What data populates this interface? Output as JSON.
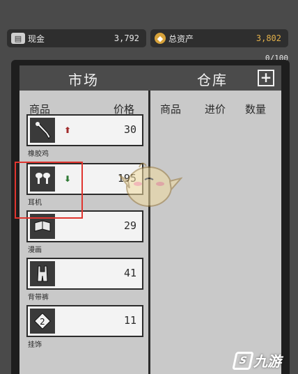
{
  "header": {
    "cash": {
      "label": "现金",
      "value": "3,792",
      "icon": "cash-stack-icon"
    },
    "total_assets": {
      "label": "总资产",
      "value": "3,802",
      "icon": "asset-coin-icon"
    }
  },
  "capacity": "0/100",
  "market": {
    "title": "市场",
    "col_item": "商品",
    "col_price": "价格",
    "items": [
      {
        "name": "橡胶鸡",
        "price": "30",
        "trend": "up",
        "trend_glyph": "⬆",
        "icon": "rubber-chicken-icon"
      },
      {
        "name": "耳机",
        "price": "195",
        "trend": "down",
        "trend_glyph": "⬇",
        "icon": "earbuds-icon"
      },
      {
        "name": "漫画",
        "price": "29",
        "trend": "none",
        "trend_glyph": "",
        "icon": "comic-book-icon"
      },
      {
        "name": "背带裤",
        "price": "41",
        "trend": "none",
        "trend_glyph": "",
        "icon": "overalls-icon"
      },
      {
        "name": "挂饰",
        "price": "11",
        "trend": "none",
        "trend_glyph": "",
        "icon": "pendant-icon"
      }
    ]
  },
  "warehouse": {
    "title": "仓库",
    "add_label": "+",
    "col_item": "商品",
    "col_cost": "进价",
    "col_qty": "数量"
  },
  "watermark": {
    "text": "九游",
    "mark": "S"
  },
  "colors": {
    "background": "#4a4a4a",
    "panel": "#1e1e1e",
    "content": "#c9c9c9",
    "title_bar": "#4b4b4b",
    "price_up": "#a12b2b",
    "price_down": "#2f7a35",
    "highlight": "#e0352f",
    "gold": "#e2b04a"
  }
}
